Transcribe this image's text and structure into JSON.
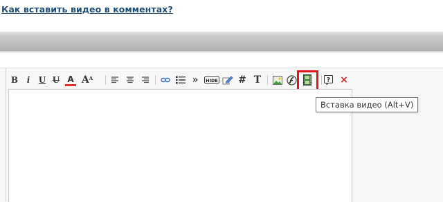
{
  "header": {
    "title_link": "Как вставить видео в комментах?"
  },
  "toolbar": {
    "bold": "B",
    "italic": "i",
    "underline": "U",
    "strike": "U",
    "font_color": "A",
    "font_size": "A",
    "quote": "»",
    "hash": "#",
    "text": "T",
    "remove": "×",
    "hide_label": "HIDE"
  },
  "tooltip": {
    "text": "Вставка видео (Alt+V)"
  },
  "colors": {
    "link": "#1f4e79",
    "highlight": "#e0141b",
    "remove": "#cc2222"
  }
}
